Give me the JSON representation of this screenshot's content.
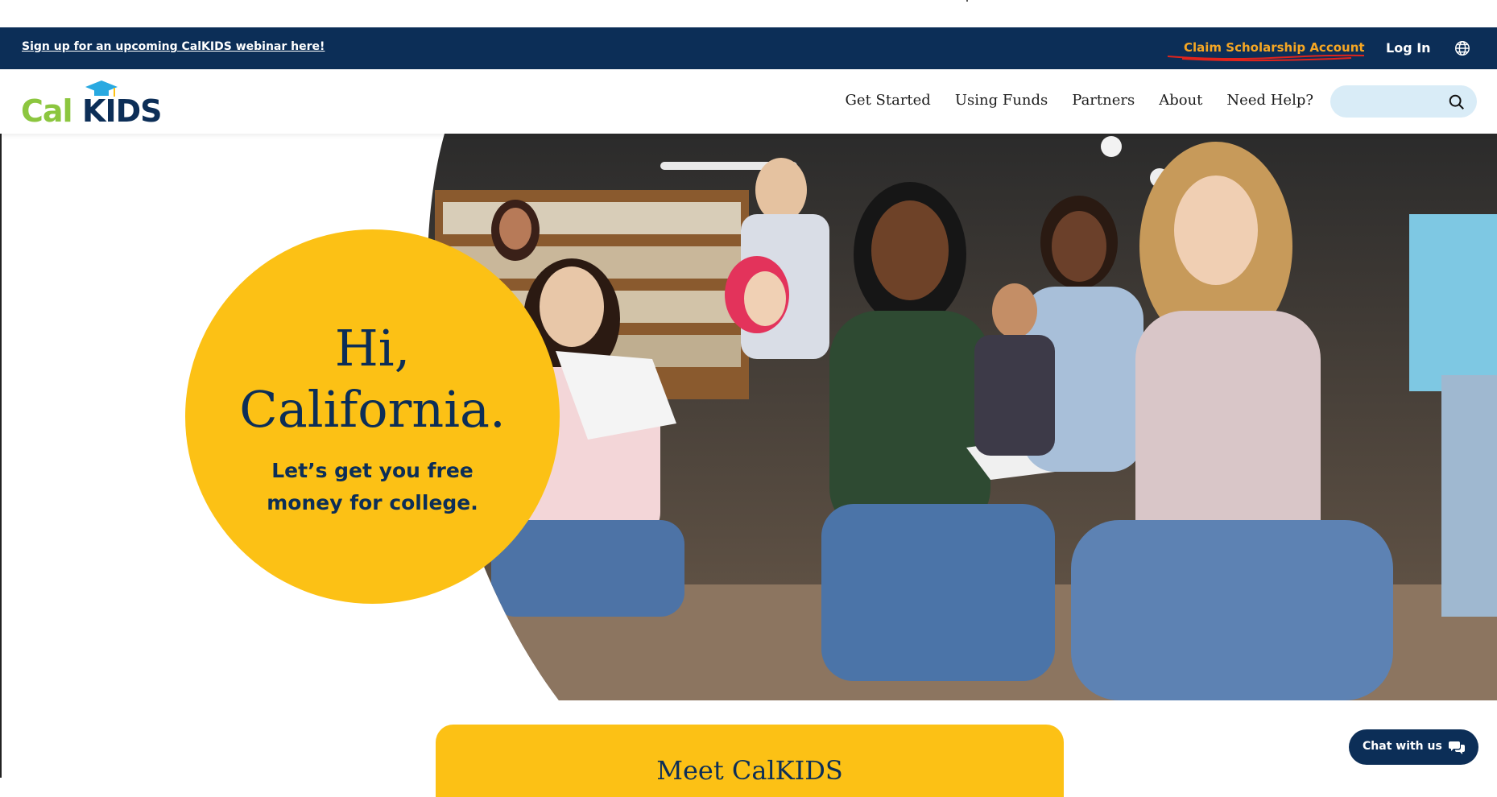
{
  "announcement": {
    "webinar_link": "Sign up for an upcoming CalKIDS webinar here!",
    "claim_link": "Claim Scholarship Account",
    "login_link": "Log In",
    "language_icon": "globe-icon"
  },
  "header": {
    "logo_cal": "Cal",
    "logo_kids": "KIDS",
    "nav": [
      "Get Started",
      "Using Funds",
      "Partners",
      "About",
      "Need Help?"
    ],
    "search_placeholder": "",
    "search_icon": "search-icon"
  },
  "hero": {
    "title_line1": "Hi,",
    "title_line2": "California.",
    "subtitle_line1": "Let’s get you free",
    "subtitle_line2": "money for college."
  },
  "meet": {
    "title": "Meet CalKIDS"
  },
  "chat": {
    "label": "Chat with us",
    "icon": "chat-bubbles-icon"
  },
  "colors": {
    "navy": "#0c2e57",
    "yellow": "#fcc115",
    "green": "#8cc63f",
    "orange": "#f5a623",
    "search_bg": "#d9ecf7"
  }
}
